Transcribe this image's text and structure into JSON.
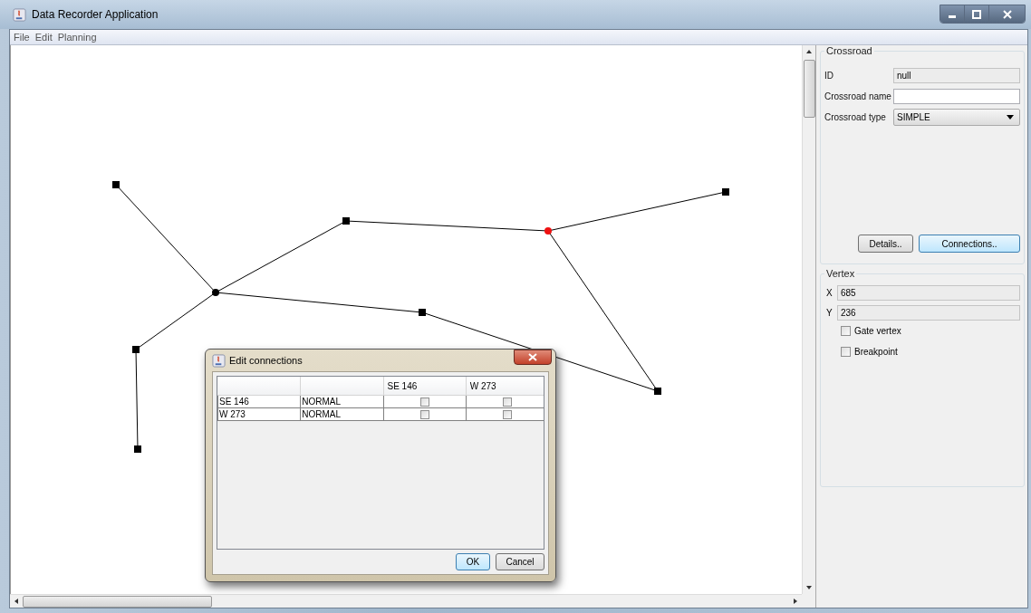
{
  "window": {
    "title": "Data Recorder Application"
  },
  "menu": [
    {
      "label": "File"
    },
    {
      "label": "Edit"
    },
    {
      "label": "Planning"
    }
  ],
  "graph": {
    "vertices": [
      {
        "kind": "endpoint",
        "selected": false
      },
      {
        "kind": "junction",
        "selected": false
      },
      {
        "kind": "endpoint",
        "selected": false
      },
      {
        "kind": "junction",
        "selected": true
      },
      {
        "kind": "endpoint",
        "selected": false
      },
      {
        "kind": "endpoint",
        "selected": false
      },
      {
        "kind": "endpoint",
        "selected": false
      },
      {
        "kind": "endpoint",
        "selected": false
      },
      {
        "kind": "endpoint",
        "selected": false
      }
    ]
  },
  "crossroad_panel": {
    "title": "Crossroad",
    "fields": [
      {
        "label": "ID",
        "value": "null",
        "kind": "readonly"
      },
      {
        "label": "Crossroad name",
        "kind": "text"
      },
      {
        "label": "Crossroad type",
        "value": "SIMPLE",
        "kind": "combo"
      }
    ],
    "buttons": [
      {
        "label": "Details..",
        "focused": false
      },
      {
        "label": "Connections..",
        "focused": true
      }
    ]
  },
  "vertex_panel": {
    "title": "Vertex",
    "fields": [
      {
        "label": "X",
        "value": "685"
      },
      {
        "label": "Y",
        "value": "236"
      }
    ],
    "checkboxes": [
      {
        "label": "Gate vertex",
        "checked": false
      },
      {
        "label": "Breakpoint",
        "checked": false
      }
    ]
  },
  "dialog": {
    "title": "Edit connections",
    "columns": [
      {
        "label": "SE 146"
      },
      {
        "label": "W 273"
      }
    ],
    "rows": [
      {
        "name": "SE 146",
        "type": "NORMAL",
        "connections": [
          {
            "checked": false
          },
          {
            "checked": false
          }
        ]
      },
      {
        "name": "W 273",
        "type": "NORMAL",
        "connections": [
          {
            "checked": false
          },
          {
            "checked": false
          }
        ]
      }
    ],
    "buttons": [
      {
        "label": "OK",
        "focused": true
      },
      {
        "label": "Cancel",
        "focused": false
      }
    ]
  }
}
